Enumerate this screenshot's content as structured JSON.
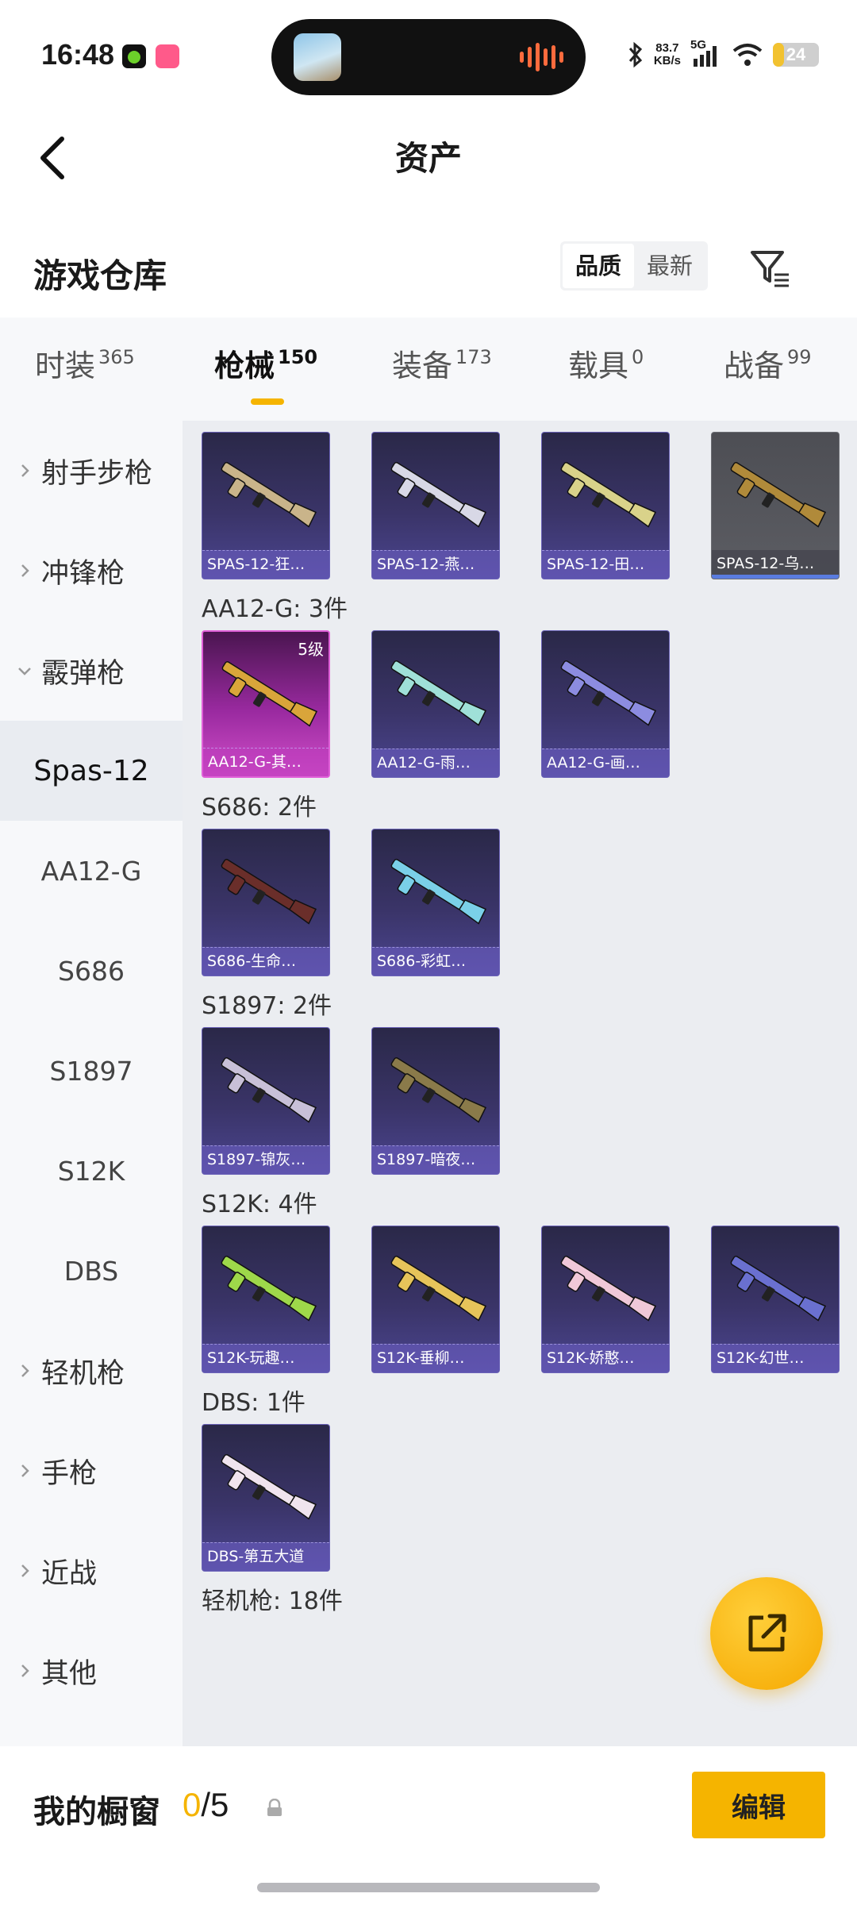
{
  "status_bar": {
    "time": "16:48",
    "net_speed_value": "83.7",
    "net_speed_unit": "KB/s",
    "network": "5G",
    "battery": "24",
    "battery_level": 0.24,
    "icons": [
      "app-green-icon",
      "app-pink-icon",
      "bluetooth-icon",
      "signal-icon",
      "wifi-icon",
      "battery-icon"
    ]
  },
  "header": {
    "title": "资产",
    "back_icon": "chevron-left-icon"
  },
  "section": {
    "title": "游戏仓库",
    "sort_options": [
      "品质",
      "最新"
    ],
    "sort_selected": "品质",
    "filter_icon": "filter-icon"
  },
  "tabs": [
    {
      "label": "时装",
      "count": "365"
    },
    {
      "label": "枪械",
      "count": "150",
      "active": true
    },
    {
      "label": "装备",
      "count": "173"
    },
    {
      "label": "载具",
      "count": "0"
    },
    {
      "label": "战备",
      "count": "99"
    }
  ],
  "sidebar": {
    "items": [
      {
        "label": "射手步枪",
        "type": "category",
        "expanded": false
      },
      {
        "label": "冲锋枪",
        "type": "category",
        "expanded": false
      },
      {
        "label": "霰弹枪",
        "type": "category",
        "expanded": true
      },
      {
        "label": "Spas-12",
        "type": "sub",
        "selected": true
      },
      {
        "label": "AA12-G",
        "type": "sub"
      },
      {
        "label": "S686",
        "type": "sub"
      },
      {
        "label": "S1897",
        "type": "sub"
      },
      {
        "label": "S12K",
        "type": "sub"
      },
      {
        "label": "DBS",
        "type": "sub"
      },
      {
        "label": "轻机枪",
        "type": "category",
        "expanded": false
      },
      {
        "label": "手枪",
        "type": "category",
        "expanded": false
      },
      {
        "label": "近战",
        "type": "category",
        "expanded": false
      },
      {
        "label": "其他",
        "type": "category",
        "expanded": false
      }
    ]
  },
  "groups": [
    {
      "title": "",
      "items": [
        {
          "name": "SPAS-12-狂…",
          "color": "#c9b48a"
        },
        {
          "name": "SPAS-12-燕…",
          "color": "#d8d8e6"
        },
        {
          "name": "SPAS-12-田…",
          "color": "#d9d28a"
        },
        {
          "name": "SPAS-12-乌…",
          "color": "#b08a3a",
          "style": "gray"
        }
      ]
    },
    {
      "title": "AA12-G: 3件",
      "items": [
        {
          "name": "AA12-G-其…",
          "color": "#d9a53a",
          "style": "pink",
          "level": "5级"
        },
        {
          "name": "AA12-G-雨…",
          "color": "#9fe0d8"
        },
        {
          "name": "AA12-G-画…",
          "color": "#8c8ce0"
        }
      ]
    },
    {
      "title": "S686: 2件",
      "items": [
        {
          "name": "S686-生命…",
          "color": "#6a2e2a"
        },
        {
          "name": "S686-彩虹…",
          "color": "#7ad0e8"
        }
      ]
    },
    {
      "title": "S1897: 2件",
      "items": [
        {
          "name": "S1897-锦灰…",
          "color": "#c8c0d8"
        },
        {
          "name": "S1897-暗夜…",
          "color": "#8a7a4a"
        }
      ]
    },
    {
      "title": "S12K: 4件",
      "items": [
        {
          "name": "S12K-玩趣…",
          "color": "#9ed84a"
        },
        {
          "name": "S12K-垂柳…",
          "color": "#e6c45a"
        },
        {
          "name": "S12K-娇憨…",
          "color": "#f0c8d8"
        },
        {
          "name": "S12K-幻世…",
          "color": "#6a70d0"
        }
      ]
    },
    {
      "title": "DBS: 1件",
      "items": [
        {
          "name": "DBS-第五大道",
          "color": "#f0e4ee"
        }
      ]
    },
    {
      "title": "轻机枪: 18件",
      "items": []
    }
  ],
  "fab": {
    "icon": "share-external-icon"
  },
  "bottom": {
    "label": "我的橱窗",
    "count_current": "0",
    "count_total": "/5",
    "lock_icon": "lock-icon",
    "edit_label": "编辑"
  }
}
